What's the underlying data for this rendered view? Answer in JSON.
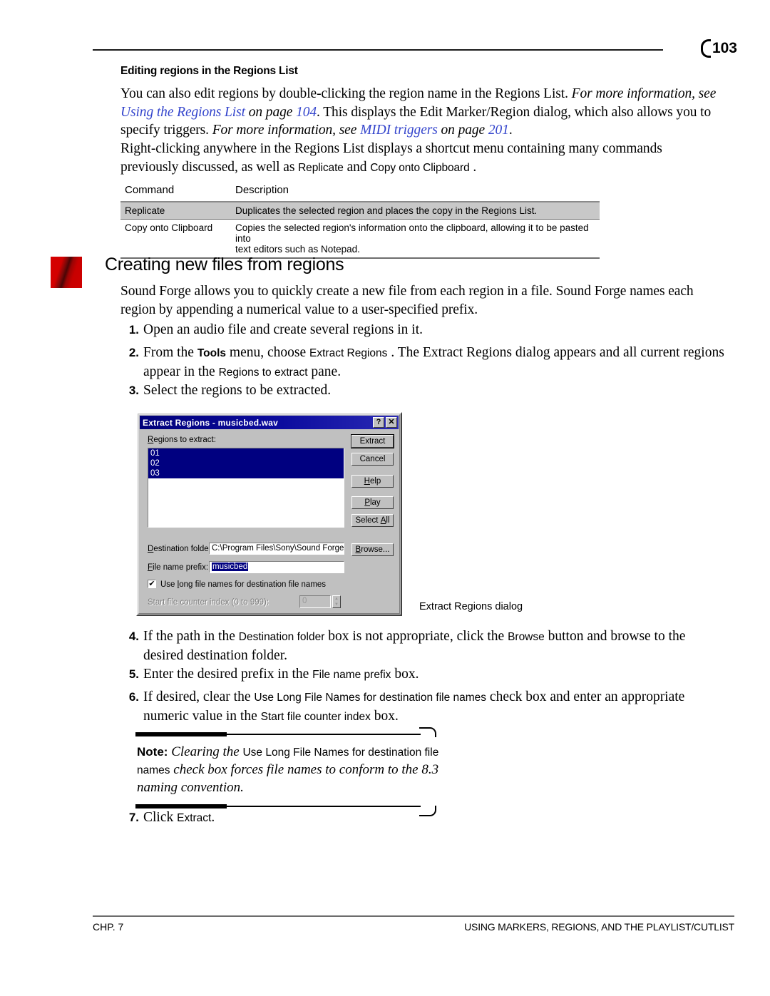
{
  "header": {
    "page_number": "103",
    "subheading": "Editing regions in the Regions List"
  },
  "paragraphs": {
    "p1_a": "You can also edit regions by double-clicking the region name in the Regions List. ",
    "p1_b": "For more information, see ",
    "p1_link1": "Using the Regions List",
    "p1_c": " on page ",
    "p1_link2": "104",
    "p1_d": ". This displays the Edit Marker/Region dialog, which also allows you to specify triggers. ",
    "p1_e": "For more information, see ",
    "p1_link3": "MIDI triggers",
    "p1_f": " on page ",
    "p1_link4": "201",
    "p1_g": ".",
    "p2_a": "Right-clicking anywhere in the Regions List displays a shortcut menu containing many commands previously discussed, as well as ",
    "p2_ui1": "Replicate",
    "p2_b": " and ",
    "p2_ui2": "Copy onto Clipboard",
    "p2_c": " ."
  },
  "command_table": {
    "headers": [
      "Command",
      "Description"
    ],
    "rows": [
      {
        "command": "Replicate",
        "description_line1": "Duplicates the selected region and places the copy in the Regions List.",
        "description_line2": "",
        "shaded": true
      },
      {
        "command": "Copy onto Clipboard",
        "description_line1": "Copies the selected region's information onto the clipboard, allowing it to be pasted into",
        "description_line2": "text editors such as Notepad.",
        "shaded": false
      }
    ]
  },
  "section": {
    "heading": "Creating new files from regions",
    "intro": "Sound Forge allows you to quickly create a new file from each region in a file. Sound Forge names each region by appending a numerical value to a user-specified prefix."
  },
  "steps": {
    "s1_num": "1.",
    "s1_text": "Open an audio file and create several regions in it.",
    "s2_num": "2.",
    "s2_a": "From the ",
    "s2_ui_tools": "Tools",
    "s2_b": " menu, choose ",
    "s2_ui_extract": "Extract Regions",
    "s2_c": " . The Extract Regions dialog appears and all current regions appear in the ",
    "s2_ui_pane": "Regions to extract",
    "s2_d": " pane.",
    "s3_num": "3.",
    "s3_text": "Select the regions to be extracted.",
    "s4_num": "4.",
    "s4_a": "If the path in the ",
    "s4_ui_dest": "Destination folder",
    "s4_b": " box is not appropriate, click the ",
    "s4_ui_browse": "Browse",
    "s4_c": " button and browse to the desired destination folder.",
    "s5_num": "5.",
    "s5_a": "Enter the desired prefix in the ",
    "s5_ui_prefix": "File name prefix",
    "s5_b": " box.",
    "s6_num": "6.",
    "s6_a": "If desired, clear the ",
    "s6_ui_long": "Use Long File Names for destination file names",
    "s6_b": " check box and enter an appropriate numeric value in the ",
    "s6_ui_start": "Start file counter index",
    "s6_c": " box.",
    "s7_num": "7.",
    "s7_a": "Click ",
    "s7_ui_extract": "Extract",
    "s7_b": "."
  },
  "dialog": {
    "title": "Extract Regions - musicbed.wav",
    "help_button_glyph": "?",
    "close_button_glyph": "✕",
    "listbox_label": "Regions to extract:",
    "listbox_label_accel": "R",
    "regions": [
      {
        "name": "01",
        "selected": true
      },
      {
        "name": "02",
        "selected": true
      },
      {
        "name": "03",
        "selected": true
      }
    ],
    "buttons": [
      {
        "label": "Extract",
        "accel": "",
        "default": true
      },
      {
        "label": "Cancel",
        "accel": "",
        "default": false
      },
      {
        "label": "Help",
        "accel": "H",
        "default": false
      },
      {
        "label": "Play",
        "accel": "P",
        "default": false
      },
      {
        "label": "Select All",
        "accel": "A",
        "default": false
      },
      {
        "label": "Browse...",
        "accel": "B",
        "default": false
      }
    ],
    "destination_label": "Destination folder:",
    "destination_accel": "D",
    "destination_value": "C:\\Program Files\\Sony\\Sound Forge",
    "prefix_label": "File name prefix:",
    "prefix_accel": "F",
    "prefix_value": "musicbed",
    "checkbox_label": "Use long file names for destination file names",
    "checkbox_accel": "l",
    "checkbox_checked": true,
    "checkbox_glyph": "✔",
    "counter_label": "Start file counter index (0 to 999):",
    "counter_value": "0",
    "counter_disabled": true,
    "spinner_up": "▲",
    "spinner_down": "▼"
  },
  "figure_caption": "Extract Regions dialog",
  "note": {
    "label": "Note:",
    "a": " Clearing the ",
    "ui": "Use Long File Names for destination file names",
    "b": " check box forces file names to conform to the 8.3 naming convention."
  },
  "footer": {
    "left": "CHP. 7",
    "right": "USING MARKERS, REGIONS, AND THE PLAYLIST/CUTLIST"
  },
  "colors": {
    "xref_blue": "#3344cc",
    "title_bar_navy": "#00007a",
    "selection_navy": "#000080",
    "dialog_face": "#c0c0c0",
    "table_shade": "#c8c8c8",
    "section_icon_red": "#d60000"
  }
}
